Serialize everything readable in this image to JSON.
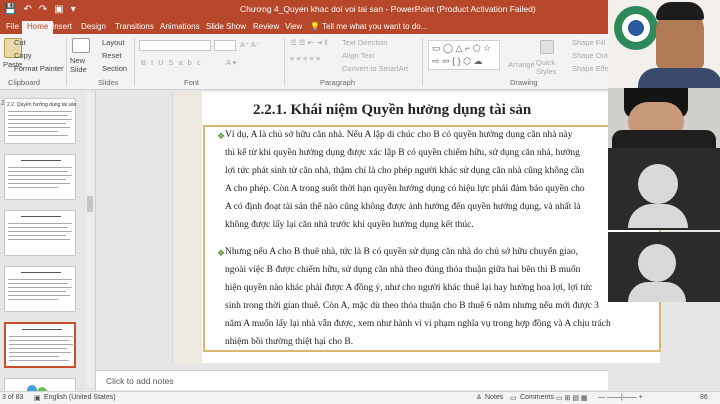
{
  "titlebar": {
    "title": "Chương 4_Quyen khac doi voi tai san - PowerPoint (Product Activation Failed)",
    "qat": [
      "💾",
      "↶",
      "↷",
      "▣",
      "▾"
    ]
  },
  "tabs": [
    "File",
    "Home",
    "Insert",
    "Design",
    "Transitions",
    "Animations",
    "Slide Show",
    "Review",
    "View"
  ],
  "tell_me": "Tell me what you want to do...",
  "ribbon": {
    "clipboard": {
      "cut": "Cut",
      "copy": "Copy",
      "format_painter": "Format Painter",
      "paste": "Paste",
      "label": "Clipboard"
    },
    "slides": {
      "new_slide": "New Slide",
      "layout": "Layout",
      "reset": "Reset",
      "section": "Section",
      "label": "Slides"
    },
    "font": {
      "label": "Font"
    },
    "paragraph": {
      "text_direction": "Text Direction",
      "align_text": "Align Text",
      "convert": "Convert to SmartArt",
      "label": "Paragraph"
    },
    "drawing": {
      "arrange": "Arrange",
      "quick_styles": "Quick Styles",
      "shape_fill": "Shape Fill",
      "shape_outline": "Shape Outline",
      "shape_effects": "Shape Effects",
      "label": "Drawing"
    }
  },
  "thumbnails": [
    {
      "title": "2.2. Quyền hưởng dụng tài sản"
    },
    {
      "title": ""
    },
    {
      "title": ""
    },
    {
      "title": ""
    },
    {
      "title": ""
    },
    {
      "title": ""
    }
  ],
  "slide": {
    "title": "2.2.1. Khái niệm Quyền hưởng dụng tài sản",
    "paragraph1": [
      "Ví dụ, A là chủ sở hữu căn nhà. Nếu A lập di chúc cho B có quyền hưởng dụng căn nhà này",
      "thì kể từ khi quyền hưởng dụng được xác lập B có quyền chiếm hữu, sử dụng căn nhà, hưởng",
      "lợi tức phát sinh từ căn nhà, thậm chí là cho phép người khác sử dụng căn nhà cũng không cần",
      "A cho phép. Còn A trong suốt thời hạn quyền hưởng dụng có hiệu lực phải đảm bảo quyền cho",
      "A có định đoạt tài sản thế nào cũng không được ảnh hưởng đến quyền hưởng dụng, và nhất là",
      "không được lấy lại căn nhà trước khi quyền hưởng dụng kết thúc."
    ],
    "paragraph2": [
      "Nhưng nếu A cho B thuê nhà, tức là B có quyền sử dụng căn nhà do chủ sở hữu chuyển giao,",
      "ngoài việc B được chiếm hữu, sử dụng căn nhà theo đúng thỏa thuận giữa hai bên thì B muốn",
      "hiện quyền nào khác phải được A đồng ý, như cho người khác thuê lại hay hưởng hoa lợi, lợi tức",
      "sinh trong thời gian thuê. Còn A, mặc dù theo thỏa thuận cho B thuê 6 năm nhưng nếu mới được 3",
      "năm A muốn lấy lại nhà vẫn được, xem như hành vi vi phạm nghĩa vụ trong hợp đồng và A chịu trách",
      "nhiệm bồi thường thiệt hại cho B."
    ]
  },
  "notes_placeholder": "Click to add notes",
  "statusbar": {
    "slide_count": "3 of 83",
    "language": "English (United States)",
    "notes": "Notes",
    "comments": "Comments",
    "zoom": "86"
  },
  "colors": {
    "accent": "#b7472a",
    "bullet": "#5a8c3a",
    "frame": "#d8b775"
  }
}
